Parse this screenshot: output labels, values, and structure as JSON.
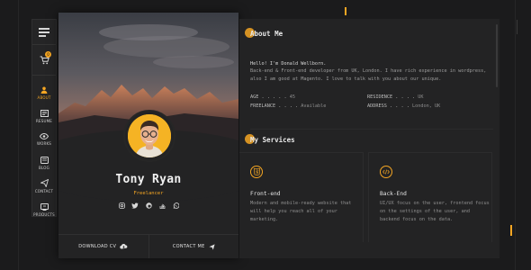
{
  "nav": {
    "menu_icon": "hamburger-icon",
    "cart_icon": "cart-icon",
    "cart_count": "0",
    "items": [
      {
        "label": "ABOUT",
        "icon": "user-icon",
        "active": true
      },
      {
        "label": "RESUME",
        "icon": "resume-icon",
        "active": false
      },
      {
        "label": "WORKS",
        "icon": "eye-icon",
        "active": false
      },
      {
        "label": "BLOG",
        "icon": "blog-icon",
        "active": false
      },
      {
        "label": "CONTACT",
        "icon": "send-icon",
        "active": false
      },
      {
        "label": "PRODUCTS",
        "icon": "products-icon",
        "active": false
      }
    ]
  },
  "profile": {
    "name": "Tony Ryan",
    "role": "Freelancer",
    "socials": [
      "instagram-icon",
      "twitter-icon",
      "github-icon",
      "stackoverflow-icon",
      "whatsapp-icon"
    ],
    "download_cv": "DOWNLOAD CV",
    "contact_me": "CONTACT ME"
  },
  "about": {
    "title": "About Me",
    "hello": "Hello! I'm Donald Wellborn.",
    "text": "Back-end & Front-end developer from UK, London. I have rich experience in wordpress, also I am good at Magento. I love to talk with you about our unique.",
    "info": [
      {
        "label": "AGE . . . . .",
        "value": "45"
      },
      {
        "label": "RESIDENCE . . . .",
        "value": "UK"
      },
      {
        "label": "FREELANCE . . . .",
        "value": "Available"
      },
      {
        "label": "ADDRESS . . . .",
        "value": "London, UK"
      }
    ]
  },
  "services": {
    "title": "My Services",
    "items": [
      {
        "title": "Front-end",
        "icon": "html5-icon",
        "desc": "Modern and mobile-ready website that will help you reach all of your marketing."
      },
      {
        "title": "Back-End",
        "icon": "code-icon",
        "desc": "UI/UX focus on the user, frontend focus on the settings of the user, and backend focus on the data."
      }
    ]
  },
  "colors": {
    "accent": "#f5a623",
    "background": "#1b1b1c",
    "panel": "#232324"
  }
}
